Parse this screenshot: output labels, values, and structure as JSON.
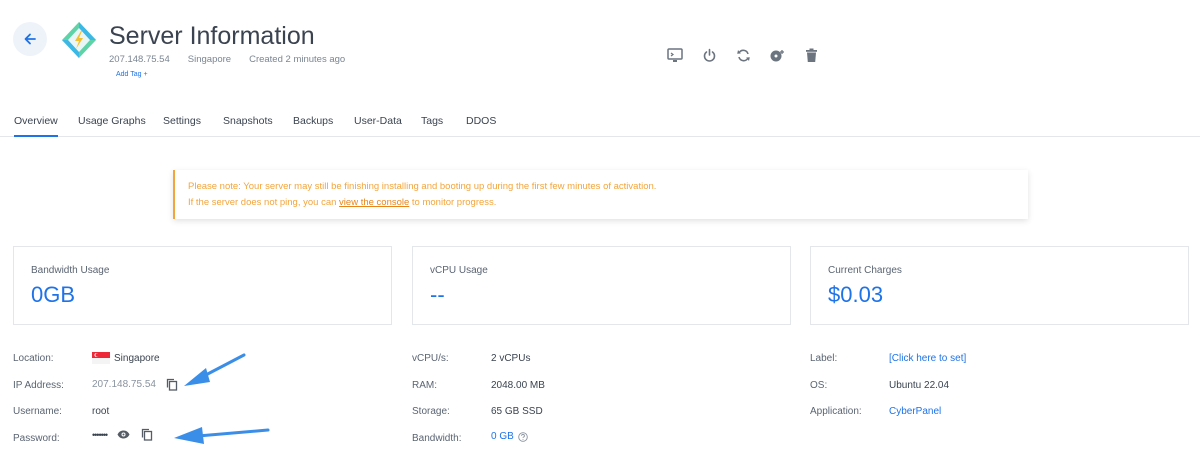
{
  "header": {
    "title": "Server Information",
    "ip": "207.148.75.54",
    "location": "Singapore",
    "created": "Created 2 minutes ago",
    "add_tag": "Add Tag +"
  },
  "toolbar": {
    "icons": [
      "console-icon",
      "power-icon",
      "restart-icon",
      "reinstall-icon",
      "trash-icon"
    ]
  },
  "tabs": [
    {
      "label": "Overview",
      "active": true
    },
    {
      "label": "Usage Graphs"
    },
    {
      "label": "Settings"
    },
    {
      "label": "Snapshots"
    },
    {
      "label": "Backups"
    },
    {
      "label": "User-Data"
    },
    {
      "label": "Tags"
    },
    {
      "label": "DDOS"
    }
  ],
  "notice": {
    "line1": "Please note: Your server may still be finishing installing and booting up during the first few minutes of activation.",
    "line2_before": "If the server does not ping, you can ",
    "line2_link": "view the console",
    "line2_after": " to monitor progress."
  },
  "cards": [
    {
      "label": "Bandwidth Usage",
      "value": "0GB"
    },
    {
      "label": "vCPU Usage",
      "value": "--"
    },
    {
      "label": "Current Charges",
      "value": "$0.03"
    }
  ],
  "details": {
    "location": {
      "label": "Location:",
      "value": "Singapore"
    },
    "ip": {
      "label": "IP Address:",
      "value": "207.148.75.54"
    },
    "username": {
      "label": "Username:",
      "value": "root"
    },
    "password": {
      "label": "Password:",
      "value": "•••••••"
    },
    "vcpu": {
      "label": "vCPU/s:",
      "value": "2 vCPUs"
    },
    "ram": {
      "label": "RAM:",
      "value": "2048.00 MB"
    },
    "storage": {
      "label": "Storage:",
      "value": "65 GB SSD"
    },
    "bandwidth": {
      "label": "Bandwidth:",
      "value": "0 GB"
    },
    "server_label": {
      "label": "Label:",
      "value": "[Click here to set]"
    },
    "os": {
      "label": "OS:",
      "value": "Ubuntu 22.04"
    },
    "application": {
      "label": "Application:",
      "value": "CyberPanel"
    }
  },
  "colors": {
    "accent": "#1e73e8",
    "warning": "#f3a53b",
    "annotation_arrow": "#3b8ee8"
  }
}
